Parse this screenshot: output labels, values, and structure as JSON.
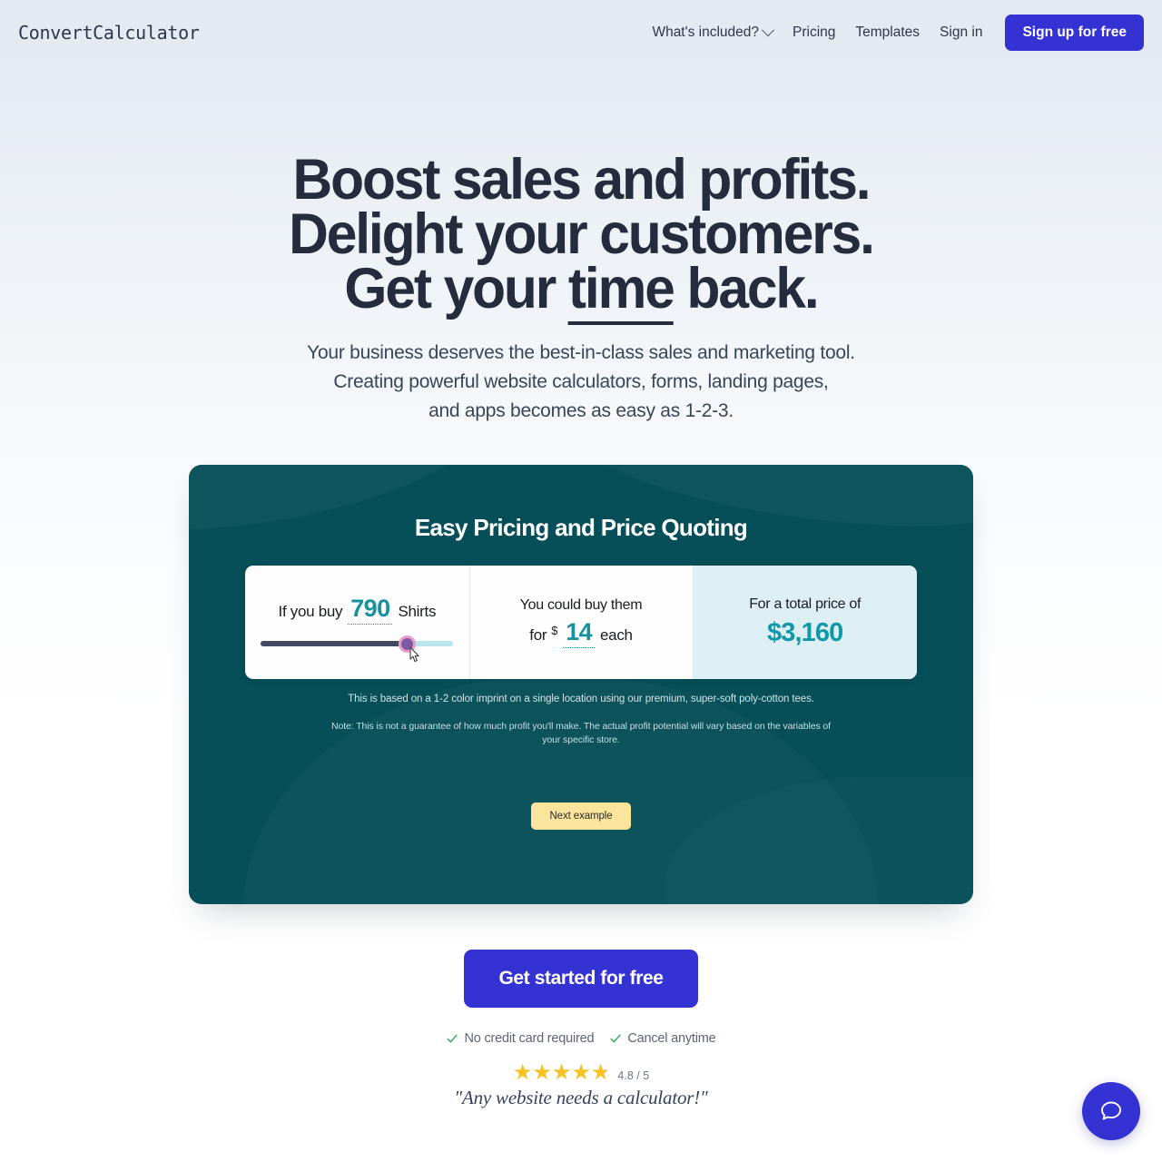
{
  "header": {
    "logo": "ConvertCalculator",
    "nav": [
      {
        "label": "What's included?",
        "has_chevron": true
      },
      {
        "label": "Pricing",
        "has_chevron": false
      },
      {
        "label": "Templates",
        "has_chevron": false
      },
      {
        "label": "Sign in",
        "has_chevron": false
      }
    ],
    "signup_button": "Sign up for free",
    "accent_color": "#3532d4"
  },
  "hero": {
    "headline_line1": "Boost sales and profits.",
    "headline_line2": "Delight your customers.",
    "headline_line3_pre": "Get your ",
    "headline_line3_underlined": "time",
    "headline_line3_post": " back.",
    "subhead_line1": "Your business deserves the best-in-class sales and marketing tool.",
    "subhead_line2": "Creating powerful website calculators, forms, landing pages,",
    "subhead_line3": "and apps becomes as easy as 1-2-3."
  },
  "calculator_card": {
    "background_color": "#074f58",
    "title": "Easy Pricing and Price Quoting",
    "panel_quantity": {
      "prefix": "If you buy",
      "value": "790",
      "suffix": "Shirts",
      "slider": {
        "percent": 76,
        "fill_color": "#414a61",
        "track_color": "#b9e4ea",
        "handle_color": "#7c5ba6",
        "handle_ring_color": "#f09bc4"
      }
    },
    "panel_unit_price": {
      "line1": "You could buy them",
      "for_label": "for",
      "currency": "$",
      "value": "14",
      "each_label": "each"
    },
    "panel_total": {
      "label": "For a total price of",
      "value": "$3,160",
      "background_color": "#ddeff3",
      "value_color": "#0e98a8"
    },
    "fineprint": "This is based on a 1-2 color imprint on a single location using our premium, super-soft poly-cotton tees.",
    "note": "Note: This is not a guarantee of how much profit you'll make. The actual profit potential will vary based on the variables of your specific store.",
    "next_button": "Next example",
    "next_button_color": "#fbe49b"
  },
  "cta": {
    "button": "Get started for free",
    "trust": [
      {
        "label": "No credit card required"
      },
      {
        "label": "Cancel anytime"
      }
    ],
    "rating_value": "4.8 / 5",
    "rating_stars": 4.8,
    "testimonial": "\"Any website needs a calculator!\"",
    "star_glyphs": "★★★★★"
  },
  "chat": {
    "label": "chat-bubble-icon"
  }
}
